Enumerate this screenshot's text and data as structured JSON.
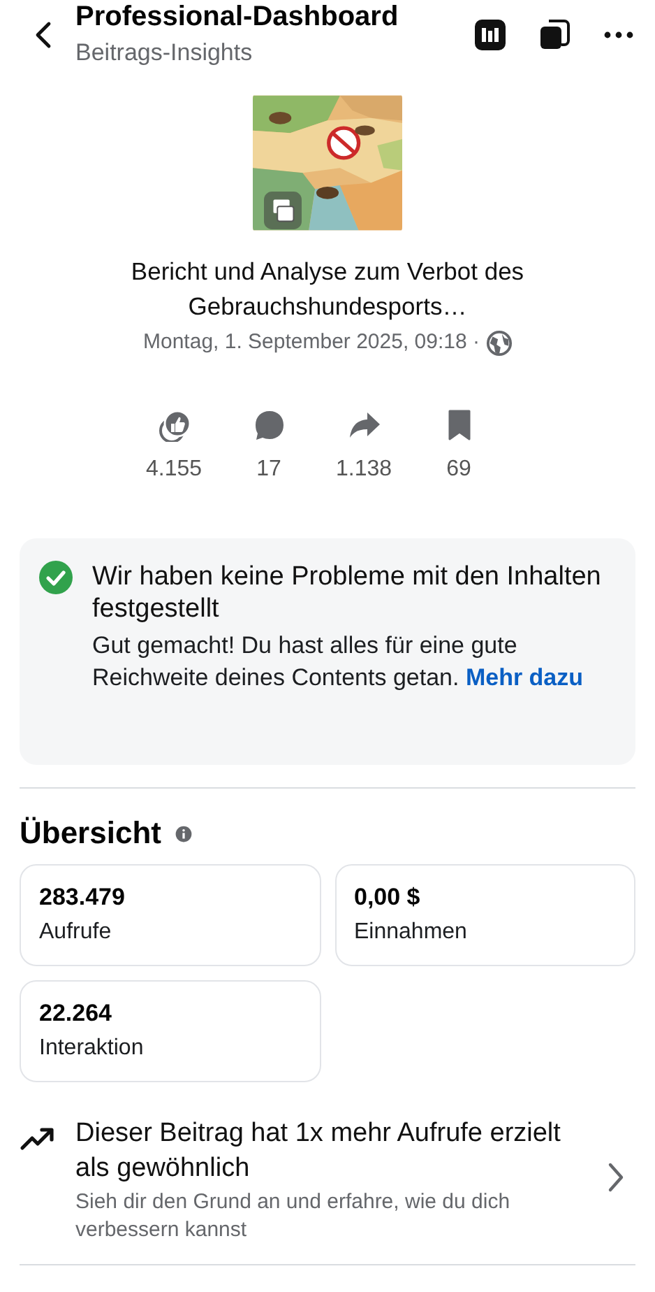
{
  "header": {
    "title": "Professional-Dashboard",
    "subtitle": "Beitrags-Insights"
  },
  "post": {
    "title": "Bericht und Analyse zum Verbot des Gebrauchshundesports…",
    "date": "Montag, 1. September 2025, 09:18 ·"
  },
  "stats": [
    {
      "kind": "reactions",
      "value": "4.155"
    },
    {
      "kind": "comments",
      "value": "17"
    },
    {
      "kind": "shares",
      "value": "1.138"
    },
    {
      "kind": "saves",
      "value": "69"
    }
  ],
  "notice": {
    "title": "Wir haben keine Probleme mit den Inhalten festgestellt",
    "text": "Gut gemacht! Du hast alles für eine gute Reichweite deines Contents getan.",
    "link": "Mehr dazu"
  },
  "overview": {
    "title": "Übersicht",
    "metrics": [
      {
        "value": "283.479",
        "label": "Aufrufe"
      },
      {
        "value": "0,00 $",
        "label": "Einnahmen"
      },
      {
        "value": "22.264",
        "label": "Interaktion"
      }
    ]
  },
  "insight": {
    "title": "Dieser Beitrag hat 1x mehr Aufrufe erzielt als gewöhnlich",
    "text": "Sieh dir den Grund an und erfahre, wie du dich verbessern kannst"
  }
}
